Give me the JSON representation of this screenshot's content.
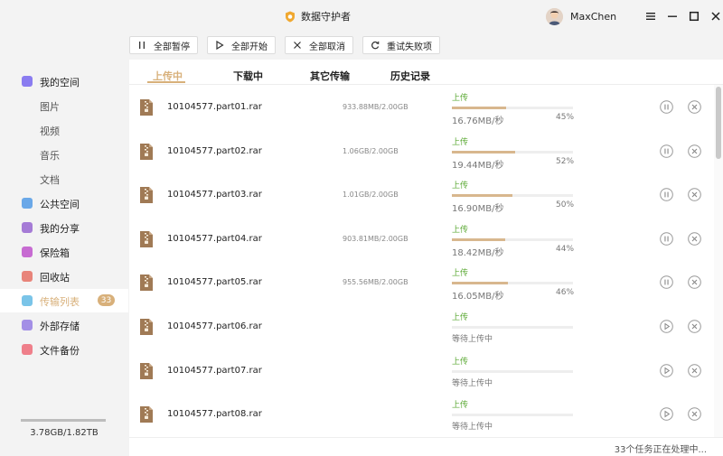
{
  "app": {
    "title": "数据守护者",
    "user_name": "MaxChen"
  },
  "toolbar": {
    "pause_all": "全部暂停",
    "start_all": "全部开始",
    "cancel_all": "全部取消",
    "retry_failed": "重试失败项"
  },
  "sidebar": {
    "items": [
      {
        "label": "我的空间",
        "icon": "folder-icon",
        "color": "#8a7cf0"
      },
      {
        "label": "图片"
      },
      {
        "label": "视频"
      },
      {
        "label": "音乐"
      },
      {
        "label": "文档"
      },
      {
        "label": "公共空间",
        "icon": "send-icon",
        "color": "#6aa8e8"
      },
      {
        "label": "我的分享",
        "icon": "share-icon",
        "color": "#a57bd6"
      },
      {
        "label": "保险箱",
        "icon": "safe-icon",
        "color": "#c76bd2"
      },
      {
        "label": "回收站",
        "icon": "trash-icon",
        "color": "#e8847a"
      },
      {
        "label": "传输列表",
        "icon": "transfer-icon",
        "color": "#7ac4e8",
        "badge": "33"
      },
      {
        "label": "外部存储",
        "icon": "usb-icon",
        "color": "#a38fe6"
      },
      {
        "label": "文件备份",
        "icon": "backup-icon",
        "color": "#ef7f8a"
      }
    ],
    "storage_text": "3.78GB/1.82TB"
  },
  "tabs": [
    "上传中",
    "下载中",
    "其它传输",
    "历史记录"
  ],
  "rows": [
    {
      "name": "10104577.part01.rar",
      "size": "933.88MB/2.00GB",
      "status": "上传",
      "speed": "16.76MB/秒",
      "percent": "45%",
      "progress": 45
    },
    {
      "name": "10104577.part02.rar",
      "size": "1.06GB/2.00GB",
      "status": "上传",
      "speed": "19.44MB/秒",
      "percent": "52%",
      "progress": 52
    },
    {
      "name": "10104577.part03.rar",
      "size": "1.01GB/2.00GB",
      "status": "上传",
      "speed": "16.90MB/秒",
      "percent": "50%",
      "progress": 50
    },
    {
      "name": "10104577.part04.rar",
      "size": "903.81MB/2.00GB",
      "status": "上传",
      "speed": "18.42MB/秒",
      "percent": "44%",
      "progress": 44
    },
    {
      "name": "10104577.part05.rar",
      "size": "955.56MB/2.00GB",
      "status": "上传",
      "speed": "16.05MB/秒",
      "percent": "46%",
      "progress": 46
    },
    {
      "name": "10104577.part06.rar",
      "size": "",
      "status": "上传",
      "wait": "等待上传中",
      "progress": 0
    },
    {
      "name": "10104577.part07.rar",
      "size": "",
      "status": "上传",
      "wait": "等待上传中",
      "progress": 0
    },
    {
      "name": "10104577.part08.rar",
      "size": "",
      "status": "上传",
      "wait": "等待上传中",
      "progress": 0
    }
  ],
  "footer": {
    "text": "33个任务正在处理中..."
  },
  "colors": {
    "accent": "#d8b07a",
    "status_green": "#5aa833",
    "file_icon": "#a07a55"
  }
}
